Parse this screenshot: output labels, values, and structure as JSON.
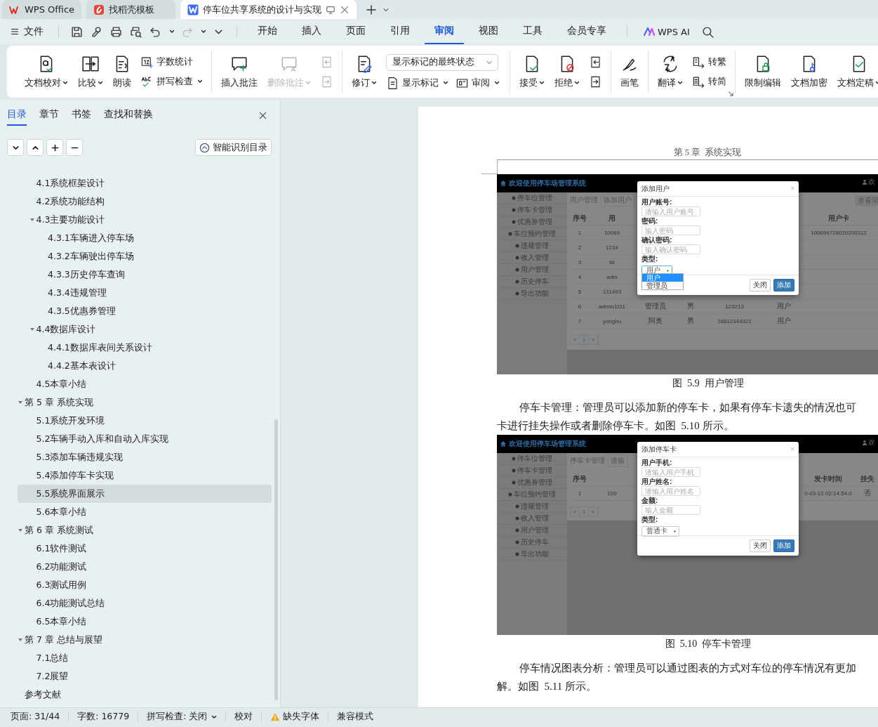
{
  "title_tabs": [
    {
      "label": "WPS Office",
      "kind": "wps",
      "selected": false
    },
    {
      "label": "找稻壳模板",
      "kind": "docer",
      "selected": false
    },
    {
      "label": "停车位共享系统的设计与实现",
      "kind": "writer",
      "selected": true
    }
  ],
  "file_menu": "文件",
  "menu_tabs": [
    {
      "label": "开始",
      "selected": false
    },
    {
      "label": "插入",
      "selected": false
    },
    {
      "label": "页面",
      "selected": false
    },
    {
      "label": "引用",
      "selected": false
    },
    {
      "label": "审阅",
      "selected": true
    },
    {
      "label": "视图",
      "selected": false
    },
    {
      "label": "工具",
      "selected": false
    },
    {
      "label": "会员专享",
      "selected": false
    }
  ],
  "ai_label": "WPS AI",
  "ribbon": {
    "groups": [
      {
        "items": [
          {
            "kind": "big",
            "label": "文档校对",
            "caret": true,
            "disabled": false
          },
          {
            "kind": "big",
            "label": "比较",
            "caret": true,
            "disabled": false
          },
          {
            "kind": "big",
            "label": "朗读",
            "caret": false,
            "disabled": false
          },
          {
            "kind": "stack",
            "items": [
              {
                "kind": "small",
                "label": "字数统计",
                "caret": false,
                "disabled": false
              },
              {
                "kind": "small",
                "label": "拼写检查",
                "caret": true,
                "disabled": false
              }
            ]
          }
        ]
      },
      {
        "items": [
          {
            "kind": "big",
            "label": "插入批注",
            "caret": false,
            "disabled": false
          },
          {
            "kind": "big",
            "label": "删除批注",
            "caret": true,
            "disabled": true
          },
          {
            "kind": "stack",
            "items": [
              {
                "kind": "small",
                "caret": false,
                "disabled": true
              },
              {
                "kind": "small",
                "caret": false,
                "disabled": true
              }
            ]
          }
        ]
      },
      {
        "items": [
          {
            "kind": "big",
            "label": "修订",
            "caret": true,
            "disabled": false
          },
          {
            "kind": "stack",
            "items": [
              {
                "kind": "select",
                "value": "显示标记的最终状态"
              },
              {
                "kind": "small",
                "label": "显示标记",
                "caret": true,
                "disabled": false
              },
              {
                "kind": "small",
                "label": "审阅",
                "caret": true,
                "disabled": false
              }
            ]
          }
        ]
      },
      {
        "items": [
          {
            "kind": "big",
            "label": "接受",
            "caret": true,
            "disabled": false
          },
          {
            "kind": "big",
            "label": "拒绝",
            "caret": true,
            "disabled": false
          },
          {
            "kind": "stack",
            "items": [
              {
                "kind": "small",
                "caret": false,
                "disabled": false
              },
              {
                "kind": "small",
                "caret": false,
                "disabled": false
              }
            ]
          }
        ]
      },
      {
        "items": [
          {
            "kind": "big",
            "label": "画笔",
            "caret": false,
            "disabled": false
          }
        ]
      },
      {
        "items": [
          {
            "kind": "big",
            "label": "翻译",
            "caret": true,
            "disabled": false
          },
          {
            "kind": "stack",
            "items": [
              {
                "kind": "small",
                "label": "转繁",
                "caret": false,
                "disabled": false
              },
              {
                "kind": "small",
                "label": "转简",
                "caret": false,
                "disabled": false
              }
            ]
          }
        ]
      },
      {
        "items": [
          {
            "kind": "big",
            "label": "限制编辑",
            "caret": false,
            "disabled": false
          },
          {
            "kind": "big",
            "label": "文档加密",
            "caret": false,
            "disabled": false
          },
          {
            "kind": "big",
            "label": "文档定稿",
            "caret": true,
            "disabled": false
          }
        ]
      }
    ]
  },
  "nav": {
    "tabs": [
      {
        "label": "目录",
        "selected": true
      },
      {
        "label": "章节",
        "selected": false
      },
      {
        "label": "书签",
        "selected": false
      },
      {
        "label": "查找和替换",
        "selected": false
      }
    ],
    "smart_button": "智能识别目录",
    "toc": [
      {
        "children": [
          {
            "label": "4.1系统框架设计",
            "selected": false
          },
          {
            "label": "4.2系统功能结构",
            "selected": false
          },
          {
            "label": "4.3主要功能设计",
            "selected": false,
            "expanded": true,
            "children": [
              {
                "label": "4.3.1车辆进入停车场",
                "selected": false
              },
              {
                "label": "4.3.2车辆驶出停车场",
                "selected": false
              },
              {
                "label": "4.3.3历史停车查询",
                "selected": false
              },
              {
                "label": "4.3.4违规管理",
                "selected": false
              },
              {
                "label": "4.3.5优惠券管理",
                "selected": false
              }
            ]
          },
          {
            "label": "4.4数据库设计",
            "selected": false,
            "expanded": true,
            "children": [
              {
                "label": "4.4.1数据库表间关系设计",
                "selected": false
              },
              {
                "label": "4.4.2基本表设计",
                "selected": false
              }
            ]
          },
          {
            "label": "4.5本章小结",
            "selected": false
          }
        ]
      },
      {
        "label": "第 5 章  系统实现",
        "selected": false,
        "expanded": true,
        "children": [
          {
            "label": "5.1系统开发环境",
            "selected": false
          },
          {
            "label": "5.2车辆手动入库和自动入库实现",
            "selected": false
          },
          {
            "label": "5.3添加车辆违规实现",
            "selected": false
          },
          {
            "label": "5.4添加停车卡实现",
            "selected": false
          },
          {
            "label": "5.5系统界面展示",
            "selected": true
          },
          {
            "label": "5.6本章小结",
            "selected": false
          }
        ]
      },
      {
        "label": "第 6 章  系统测试",
        "selected": false,
        "expanded": true,
        "children": [
          {
            "label": "6.1软件测试",
            "selected": false
          },
          {
            "label": "6.2功能测试",
            "selected": false
          },
          {
            "label": "6.3测试用例",
            "selected": false
          },
          {
            "label": "6.4功能测试总结",
            "selected": false
          },
          {
            "label": "6.5本章小结",
            "selected": false
          }
        ]
      },
      {
        "label": "第 7 章  总结与展望",
        "selected": false,
        "expanded": true,
        "children": [
          {
            "label": "7.1总结",
            "selected": false
          },
          {
            "label": "7.2展望",
            "selected": false
          }
        ]
      },
      {
        "label": "参考文献",
        "selected": false
      }
    ]
  },
  "document": {
    "running_head": "第 5 章  系统实现",
    "blocks": [
      {
        "kind": "figure",
        "screen": {
          "kind": "user",
          "app_title": "欢迎使用停车场管理系统",
          "user_link": "欢",
          "menu": [
            "停车位管理",
            "停车卡管理",
            "优惠券管理",
            "车位预约管理",
            "违规管理",
            "收入管理",
            "用户管理",
            "历史停车",
            "导出功能"
          ],
          "breadcrumb": "用户管理",
          "control": {
            "kind": "tab",
            "label": "添加用户"
          },
          "action_button": "查看用",
          "columns": [
            "序号",
            "用",
            null,
            null,
            null,
            null,
            "用户卡"
          ],
          "rows": [
            [
              "1",
              "10069",
              null,
              null,
              null,
              null,
              "100699728020200312"
            ],
            [
              "2",
              "1234",
              null,
              null,
              null,
              null,
              null
            ],
            [
              "3",
              "lis",
              null,
              null,
              null,
              null,
              null
            ],
            [
              "4",
              "adm",
              null,
              null,
              null,
              null,
              null
            ],
            [
              "5",
              "131493",
              null,
              null,
              null,
              null,
              null
            ],
            [
              "6",
              "admin1111",
              "管理员",
              "男",
              "123213",
              "用户",
              null
            ],
            [
              "7",
              "yonghu",
              "阿奥",
              "男",
              "18812344321",
              "用户",
              null
            ]
          ],
          "pager": [
            "«",
            "1",
            "»"
          ],
          "modal": {
            "title": "添加用户",
            "close": "×",
            "fields": [
              {
                "label": "用户账号:",
                "placeholder": "请输入用户账号"
              },
              {
                "label": "密码:",
                "placeholder": "输入密码"
              },
              {
                "label": "确认密码:",
                "placeholder": "输入确认密码"
              }
            ],
            "select": {
              "label": "类型:",
              "value": "用户",
              "open": true,
              "options": [
                {
                  "label": "用户",
                  "selected": true
                },
                {
                  "label": "管理员",
                  "selected": false
                }
              ]
            },
            "buttons": [
              {
                "label": "关闭",
                "kind": "default"
              },
              {
                "label": "添加",
                "kind": "primary"
              }
            ]
          }
        }
      },
      {
        "kind": "caption",
        "text": "图  5.9  用户管理"
      },
      {
        "kind": "paragraph",
        "lines": [
          "停车卡管理：管理员可以添加新的停车卡，如果有停车卡遗失的情况也可",
          "卡进行挂失操作或者删除停车卡。如图  5.10 所示。"
        ]
      },
      {
        "kind": "figure",
        "screen": {
          "kind": "card",
          "app_title": "欢迎使用停车场管理系统",
          "user_link": "欢",
          "menu": [
            "停车位管理",
            "停车卡管理",
            "优惠券管理",
            "车位预约管理",
            "违规管理",
            "收入管理",
            "用户管理",
            "历史停车",
            "导出功能"
          ],
          "breadcrumb": "停车卡管理",
          "control": {
            "kind": "search",
            "placeholder": "请输"
          },
          "columns": [
            "序号",
            null,
            null,
            "发卡时间",
            "挂失"
          ],
          "rows": [
            [
              "1",
              "100",
              null,
              "0-03-12 02:14:54.0",
              "否"
            ]
          ],
          "pager": [
            "«",
            "1",
            "»"
          ],
          "modal": {
            "title": "添加停车卡",
            "close": "×",
            "fields": [
              {
                "label": "用户手机:",
                "placeholder": "请输入用户手机"
              },
              {
                "label": "用户姓名:",
                "placeholder": "请输入用户姓名"
              },
              {
                "label": "金额:",
                "placeholder": "输入金额"
              }
            ],
            "select": {
              "label": "类型:",
              "value": "普通卡",
              "open": false
            },
            "buttons": [
              {
                "label": "关闭",
                "kind": "default"
              },
              {
                "label": "添加",
                "kind": "primary"
              }
            ]
          }
        }
      },
      {
        "kind": "caption",
        "text": "图  5.10  停车卡管理"
      },
      {
        "kind": "paragraph",
        "lines": [
          "停车情况图表分析：管理员可以通过图表的方式对车位的停车情况有更加",
          "解。如图  5.11 所示。"
        ]
      }
    ]
  },
  "status_bar": [
    {
      "kind": "text",
      "label": "页面: 31/44"
    },
    {
      "kind": "text",
      "label": "字数: 16779"
    },
    {
      "kind": "menu",
      "label": "拼写检查: 关闭"
    },
    {
      "kind": "text",
      "label": "校对"
    },
    {
      "kind": "warning",
      "label": "缺失字体"
    },
    {
      "kind": "text",
      "label": "兼容模式"
    }
  ]
}
